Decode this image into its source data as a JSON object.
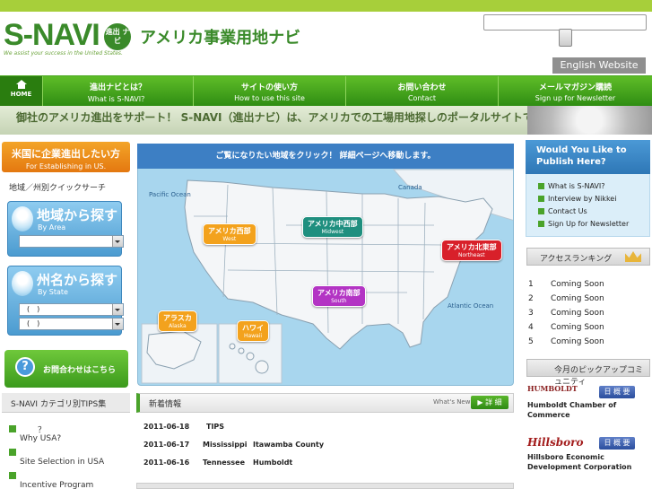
{
  "header": {
    "logo": "S-NAVI",
    "logo_badge": "進出 ナビ",
    "site_title": "アメリカ事業用地ナビ",
    "tagline": "We assist your success in the United States.",
    "english_button": "English Website"
  },
  "nav": [
    {
      "jp": "",
      "en": "HOME"
    },
    {
      "jp": "進出ナビとは？",
      "en": "What is S-NAVI？"
    },
    {
      "jp": "サイトの使い方",
      "en": "How to use this site"
    },
    {
      "jp": "お問い合わせ",
      "en": "Contact"
    },
    {
      "jp": "メールマガジン購読",
      "en": "Sign up for Newsletter"
    }
  ],
  "banner": "御社のアメリカ進出をサポート！ S-NAVI（進出ナビ）は、アメリカでの工場用地探しのポータルサイトです！",
  "left": {
    "head_jp": "米国に企業進出したい方",
    "head_en": "For Establishing in US.",
    "quick_label": "地域／州別クイックサーチ",
    "area_jp": "地域から探す",
    "area_en": "By Area",
    "state_jp": "州名から探す",
    "state_en": "By State",
    "state_sel1": "(　)",
    "state_sel2": "(　)",
    "contact": "お問合わせはこちら",
    "tips_head": "S-NAVI カテゴリ別TIPS集",
    "tips": [
      "？",
      "Why USA?",
      "Site Selection in USA",
      "Incentive Program"
    ]
  },
  "map": {
    "heading": "ご覧になりたい地域をクリック！ 詳細ページへ移動します。",
    "labels": {
      "pacific": "Pacific Ocean",
      "canada": "Canada",
      "atlantic": "Atlantic Ocean"
    },
    "regions": [
      {
        "jp": "アメリカ西部",
        "en": "West",
        "color": "#f3a21d"
      },
      {
        "jp": "アメリカ中西部",
        "en": "Midwest",
        "color": "#1f8f7f"
      },
      {
        "jp": "アメリカ北東部",
        "en": "Northeast",
        "color": "#d8202a"
      },
      {
        "jp": "アメリカ南部",
        "en": "South",
        "color": "#b334c4"
      },
      {
        "jp": "アラスカ",
        "en": "Alaska",
        "color": "#f3a21d"
      },
      {
        "jp": "ハワイ",
        "en": "Hawaii",
        "color": "#f3a21d"
      }
    ]
  },
  "news": {
    "title": "新着情報",
    "whatsnew": "What's New",
    "detail": "▶ 詳 細",
    "rows": [
      {
        "date": "2011-06-18",
        "c1": "TIPS",
        "c2": ""
      },
      {
        "date": "2011-06-17",
        "c1": "Mississippi",
        "c2": "Itawamba County"
      },
      {
        "date": "2011-06-16",
        "c1": "Tennessee",
        "c2": "Humboldt"
      }
    ]
  },
  "right": {
    "publish_head": "Would You Like to Publish Here?",
    "links": [
      "What is S-NAVI?",
      "Interview by Nikkei",
      "Contact Us",
      "Sign Up for Newsletter"
    ],
    "ranking_head": "アクセスランキング",
    "ranking": [
      {
        "n": "1",
        "t": "Coming Soon"
      },
      {
        "n": "2",
        "t": "Coming Soon"
      },
      {
        "n": "3",
        "t": "Coming Soon"
      },
      {
        "n": "4",
        "t": "Coming Soon"
      },
      {
        "n": "5",
        "t": "Coming Soon"
      }
    ],
    "pickup_head": "今月のピックアップコミュニティ",
    "communities": [
      {
        "logo": "HUMBOLDT",
        "name": "Humboldt Chamber of Commerce",
        "btn": "日 概 要"
      },
      {
        "logo": "Hillsboro",
        "name": "Hillsboro Economic Development Corporation",
        "btn": "日 概 要"
      }
    ]
  }
}
